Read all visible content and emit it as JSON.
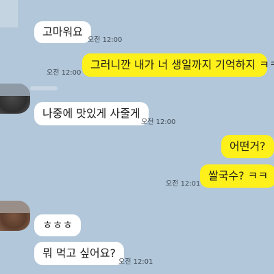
{
  "messages": [
    {
      "side": "in",
      "text": "고마워요",
      "time": "오전 12:00"
    },
    {
      "side": "out",
      "text": "그러니깐 내가 너 생일까지 기억하지 ㅋㅋ",
      "time": "오전 12:00"
    },
    {
      "side": "in",
      "text": "나중에 맛있게 사줄게",
      "time": "오전 12:00"
    },
    {
      "side": "out",
      "text": "어떤거?",
      "time": ""
    },
    {
      "side": "out",
      "text": "쌀국수? ㅋㅋ",
      "time": "오전 12:01"
    },
    {
      "side": "in",
      "text": "ㅎㅎㅎ",
      "time": ""
    },
    {
      "side": "in",
      "text": "뭐 먹고 싶어요?",
      "time": "오전 12:01"
    }
  ],
  "colors": {
    "background": "#b2c7d9",
    "incoming_bubble": "#ffffff",
    "outgoing_bubble": "#fef01b",
    "timestamp": "#3f4a55"
  }
}
